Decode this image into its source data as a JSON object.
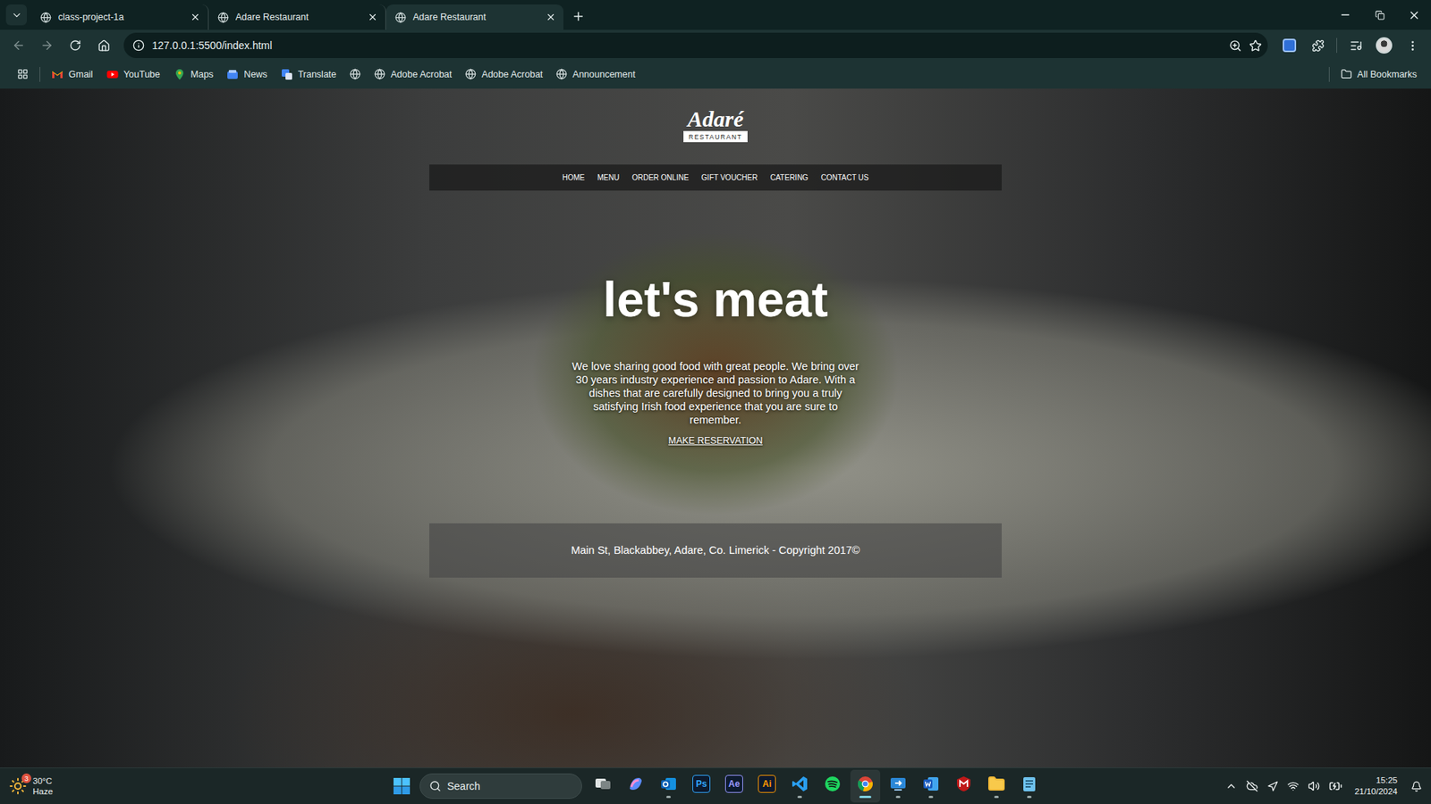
{
  "browser": {
    "tabs": [
      {
        "label": "class-project-1a",
        "selected": false
      },
      {
        "label": "Adare Restaurant",
        "selected": false
      },
      {
        "label": "Adare Restaurant",
        "selected": true
      }
    ],
    "address": "127.0.0.1:5500/index.html",
    "bookmarks": [
      {
        "kind": "gmail",
        "label": "Gmail"
      },
      {
        "kind": "youtube",
        "label": "YouTube"
      },
      {
        "kind": "maps",
        "label": "Maps"
      },
      {
        "kind": "news",
        "label": "News"
      },
      {
        "kind": "translate",
        "label": "Translate"
      },
      {
        "kind": "globe"
      },
      {
        "kind": "globe",
        "label": "Adobe Acrobat"
      },
      {
        "kind": "globe",
        "label": "Adobe Acrobat"
      },
      {
        "kind": "globe",
        "label": "Announcement"
      }
    ],
    "all_bookmarks": "All Bookmarks"
  },
  "page": {
    "logo": {
      "name": "Adaré",
      "tagline": "RESTAURANT"
    },
    "nav": [
      "HOME",
      "MENU",
      "ORDER ONLINE",
      "GIFT VOUCHER",
      "CATERING",
      "CONTACT US"
    ],
    "headline": "let's meat",
    "intro": "We love sharing good food with great people. We bring over 30 years industry experience and passion to Adare. With a dishes that are carefully designed to bring you a truly satisfying Irish food experience that you are sure to remember.",
    "cta": "MAKE RESERVATION",
    "footer": "Main St, Blackabbey, Adare, Co. Limerick - Copyright 2017©"
  },
  "taskbar": {
    "weather": {
      "temp": "30°C",
      "condition": "Haze",
      "badge": "3"
    },
    "search": "Search",
    "apps": [
      {
        "kind": "task-view",
        "running": false,
        "selected": false
      },
      {
        "kind": "copilot",
        "running": false,
        "selected": false
      },
      {
        "kind": "outlook",
        "running": true,
        "selected": false
      },
      {
        "kind": "letters",
        "text": "Ps",
        "color": "#31a8ff",
        "running": false,
        "selected": false
      },
      {
        "kind": "letters",
        "text": "Ae",
        "color": "#9999ff",
        "running": false,
        "selected": false
      },
      {
        "kind": "letters",
        "text": "Ai",
        "color": "#ff9a00",
        "running": false,
        "selected": false
      },
      {
        "kind": "vscode",
        "running": true,
        "selected": false
      },
      {
        "kind": "spotify",
        "running": false,
        "selected": false
      },
      {
        "kind": "chrome",
        "running": true,
        "selected": true
      },
      {
        "kind": "remote",
        "running": true,
        "selected": false
      },
      {
        "kind": "word",
        "running": true,
        "selected": false
      },
      {
        "kind": "mcafee",
        "running": false,
        "selected": false
      },
      {
        "kind": "explorer",
        "running": true,
        "selected": false
      },
      {
        "kind": "notepad",
        "running": true,
        "selected": false
      }
    ],
    "time": "15:25",
    "date": "21/10/2024"
  }
}
